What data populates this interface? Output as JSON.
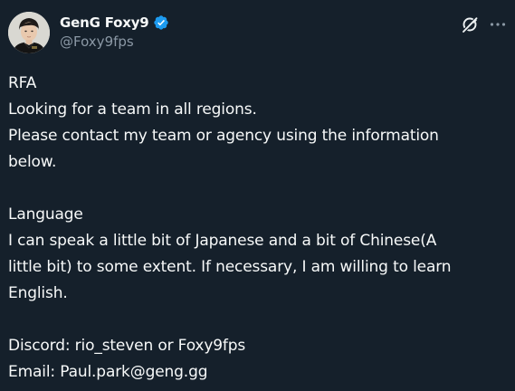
{
  "author": {
    "display_name": "GenG Foxy9",
    "handle": "@Foxy9fps",
    "verified": true,
    "avatar_icon": "profile-photo"
  },
  "actions": {
    "grok_icon": "grok-icon",
    "more_icon": "more-icon"
  },
  "colors": {
    "background": "#15202b",
    "text": "#f7f9f9",
    "secondary_text": "#8b98a5",
    "verified_badge": "#1d9bf0"
  },
  "tweet": {
    "lines": [
      "RFA",
      "Looking for a team in all regions.",
      "Please contact my team or agency using the information",
      "below.",
      "",
      "Language",
      "I can speak a little bit of Japanese and a bit of Chinese(A",
      "little bit) to some extent. If necessary, I am willing to learn",
      "English.",
      "",
      "Discord: rio_steven or Foxy9fps",
      "Email: Paul.park@geng.gg"
    ]
  }
}
